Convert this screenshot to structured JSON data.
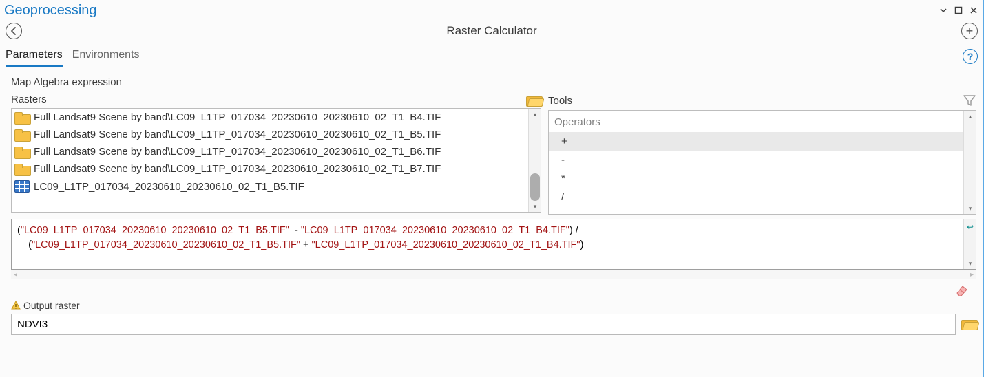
{
  "panel": {
    "title": "Geoprocessing"
  },
  "header": {
    "tool_name": "Raster Calculator"
  },
  "tabs": {
    "parameters": "Parameters",
    "environments": "Environments"
  },
  "section": {
    "map_algebra": "Map Algebra expression"
  },
  "rasters": {
    "label": "Rasters",
    "items": [
      {
        "type": "folder",
        "label": "Full Landsat9 Scene by band\\LC09_L1TP_017034_20230610_20230610_02_T1_B4.TIF"
      },
      {
        "type": "folder",
        "label": "Full Landsat9 Scene by band\\LC09_L1TP_017034_20230610_20230610_02_T1_B5.TIF"
      },
      {
        "type": "folder",
        "label": "Full Landsat9 Scene by band\\LC09_L1TP_017034_20230610_20230610_02_T1_B6.TIF"
      },
      {
        "type": "folder",
        "label": "Full Landsat9 Scene by band\\LC09_L1TP_017034_20230610_20230610_02_T1_B7.TIF"
      },
      {
        "type": "raster",
        "label": "LC09_L1TP_017034_20230610_20230610_02_T1_B5.TIF"
      }
    ]
  },
  "tools": {
    "label": "Tools",
    "group": "Operators",
    "ops": [
      "+",
      "-",
      "*",
      "/"
    ],
    "selected_index": 0
  },
  "expression": {
    "line1_prefix": "(",
    "line1_str1": "\"LC09_L1TP_017034_20230610_20230610_02_T1_B5.TIF\"",
    "line1_mid": "  - ",
    "line1_str2": "\"LC09_L1TP_017034_20230610_20230610_02_T1_B4.TIF\"",
    "line1_suffix": ") /",
    "line2_prefix": "    (",
    "line2_str1": "\"LC09_L1TP_017034_20230610_20230610_02_T1_B5.TIF\"",
    "line2_mid": " + ",
    "line2_str2": "\"LC09_L1TP_017034_20230610_20230610_02_T1_B4.TIF\"",
    "line2_suffix": ")"
  },
  "output": {
    "label": "Output raster",
    "value": "NDVI3"
  }
}
